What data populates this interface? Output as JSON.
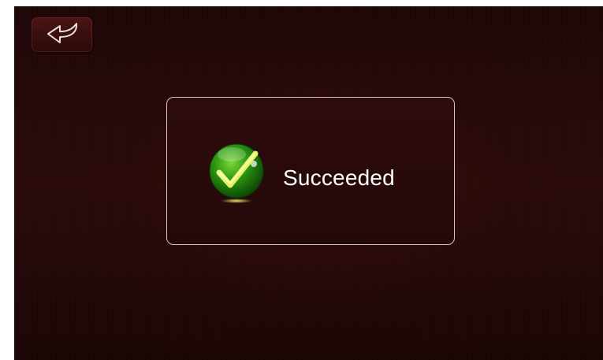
{
  "toolbar": {
    "back_icon": "back-arrow-icon"
  },
  "dialog": {
    "icon": "checkmark-icon",
    "message": "Succeeded"
  },
  "colors": {
    "background": "#240808",
    "dialog_border": "#d4c4c4",
    "icon_green": "#2f9a14",
    "check_yellow": "#e8f45a",
    "text": "#ffffff"
  }
}
